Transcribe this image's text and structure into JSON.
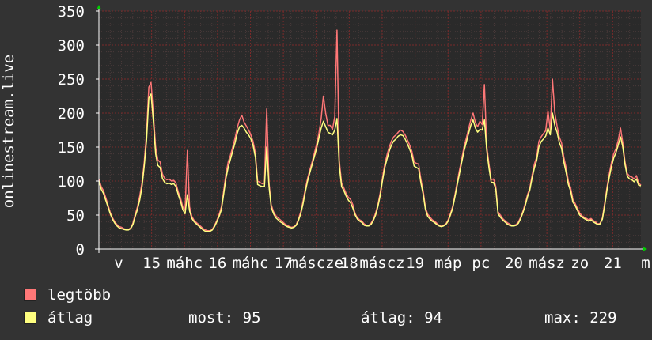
{
  "chart_data": {
    "type": "line",
    "ylabel": "onlinestream.live",
    "ylim": [
      0,
      350
    ],
    "yticks": [
      0,
      50,
      100,
      150,
      200,
      250,
      300,
      350
    ],
    "x_tick_labels": [
      "v",
      "15",
      "máhc",
      "16",
      "máhc",
      "17",
      "máscze",
      "18",
      "máscz",
      "19",
      "máp",
      "pc",
      "20",
      "mász",
      "zo",
      "21",
      "m"
    ],
    "grid": true,
    "legend_placement": "bottom-left",
    "series": [
      {
        "name": "legtöbb",
        "color": "#ff7777",
        "values": [
          103,
          92,
          86,
          76,
          65,
          54,
          46,
          40,
          36,
          33,
          32,
          30,
          29,
          29,
          31,
          38,
          51,
          62,
          78,
          98,
          128,
          170,
          238,
          245,
          200,
          150,
          131,
          128,
          110,
          104,
          102,
          103,
          100,
          101,
          97,
          84,
          75,
          62,
          57,
          145,
          62,
          48,
          42,
          39,
          36,
          33,
          30,
          28,
          27,
          27,
          29,
          35,
          42,
          51,
          62,
          85,
          110,
          128,
          138,
          150,
          163,
          178,
          190,
          197,
          187,
          181,
          175,
          168,
          158,
          141,
          100,
          98,
          96,
          97,
          206,
          97,
          65,
          55,
          49,
          46,
          43,
          40,
          37,
          35,
          33,
          32,
          33,
          36,
          44,
          55,
          70,
          88,
          104,
          116,
          128,
          141,
          154,
          170,
          192,
          225,
          200,
          182,
          182,
          176,
          195,
          322,
          130,
          97,
          90,
          82,
          76,
          73,
          65,
          52,
          46,
          43,
          41,
          37,
          35,
          35,
          38,
          44,
          53,
          65,
          82,
          104,
          124,
          138,
          150,
          159,
          165,
          168,
          172,
          175,
          173,
          168,
          161,
          153,
          144,
          128,
          126,
          125,
          102,
          85,
          61,
          51,
          47,
          43,
          41,
          38,
          35,
          35,
          35,
          37,
          43,
          52,
          63,
          80,
          98,
          116,
          133,
          150,
          163,
          177,
          190,
          200,
          186,
          180,
          188,
          183,
          242,
          152,
          125,
          102,
          103,
          92,
          55,
          50,
          45,
          42,
          39,
          37,
          35,
          35,
          36,
          40,
          47,
          56,
          67,
          80,
          90,
          108,
          125,
          135,
          158,
          165,
          170,
          174,
          203,
          175,
          250,
          201,
          181,
          165,
          156,
          135,
          120,
          100,
          90,
          73,
          67,
          60,
          53,
          49,
          47,
          45,
          43,
          45,
          42,
          40,
          37,
          38,
          46,
          67,
          90,
          110,
          127,
          140,
          148,
          160,
          178,
          156,
          128,
          111,
          107,
          106,
          103,
          108,
          97,
          94
        ]
      },
      {
        "name": "átlag",
        "color": "#ffff80",
        "values": [
          100,
          88,
          82,
          72,
          62,
          52,
          44,
          38,
          34,
          31,
          30,
          29,
          28,
          28,
          30,
          36,
          48,
          58,
          72,
          92,
          122,
          160,
          222,
          228,
          188,
          140,
          123,
          120,
          104,
          98,
          96,
          97,
          95,
          96,
          92,
          80,
          70,
          58,
          52,
          80,
          56,
          45,
          40,
          37,
          34,
          31,
          28,
          26,
          26,
          26,
          28,
          33,
          40,
          48,
          58,
          80,
          104,
          120,
          132,
          144,
          156,
          170,
          180,
          182,
          178,
          172,
          168,
          162,
          152,
          135,
          95,
          93,
          92,
          92,
          150,
          92,
          61,
          52,
          46,
          43,
          40,
          38,
          35,
          33,
          32,
          31,
          32,
          35,
          42,
          52,
          66,
          84,
          100,
          112,
          124,
          136,
          148,
          163,
          178,
          188,
          180,
          172,
          170,
          168,
          175,
          192,
          122,
          92,
          86,
          78,
          72,
          68,
          60,
          50,
          44,
          41,
          39,
          35,
          34,
          34,
          36,
          42,
          50,
          62,
          78,
          100,
          119,
          132,
          144,
          153,
          159,
          162,
          166,
          168,
          167,
          162,
          155,
          147,
          138,
          122,
          120,
          118,
          97,
          80,
          58,
          48,
          44,
          41,
          39,
          36,
          34,
          33,
          34,
          36,
          41,
          50,
          60,
          77,
          94,
          111,
          128,
          144,
          157,
          170,
          182,
          190,
          178,
          172,
          176,
          175,
          190,
          146,
          119,
          98,
          98,
          88,
          52,
          47,
          43,
          40,
          37,
          35,
          34,
          34,
          35,
          38,
          45,
          54,
          64,
          77,
          87,
          104,
          119,
          130,
          150,
          158,
          162,
          166,
          178,
          168,
          200,
          182,
          172,
          157,
          148,
          128,
          113,
          95,
          85,
          69,
          64,
          57,
          50,
          47,
          45,
          43,
          41,
          43,
          40,
          38,
          36,
          37,
          44,
          63,
          86,
          105,
          121,
          134,
          142,
          153,
          165,
          150,
          124,
          107,
          103,
          102,
          99,
          103,
          94,
          93
        ]
      }
    ]
  },
  "legend": [
    {
      "label": "legtöbb",
      "color": "#ff7777"
    },
    {
      "label": "átlag",
      "color": "#ffff80"
    }
  ],
  "stats": {
    "most": "most: 95",
    "atlag": "átlag: 94",
    "max": "max: 229"
  },
  "colors": {
    "background": "#333333",
    "plot_background": "#2a2a2a",
    "major_grid": "#7a2a2a",
    "minor_grid": "#4a3a3a",
    "axis": "#ffffff",
    "arrow": "#00cc00"
  }
}
